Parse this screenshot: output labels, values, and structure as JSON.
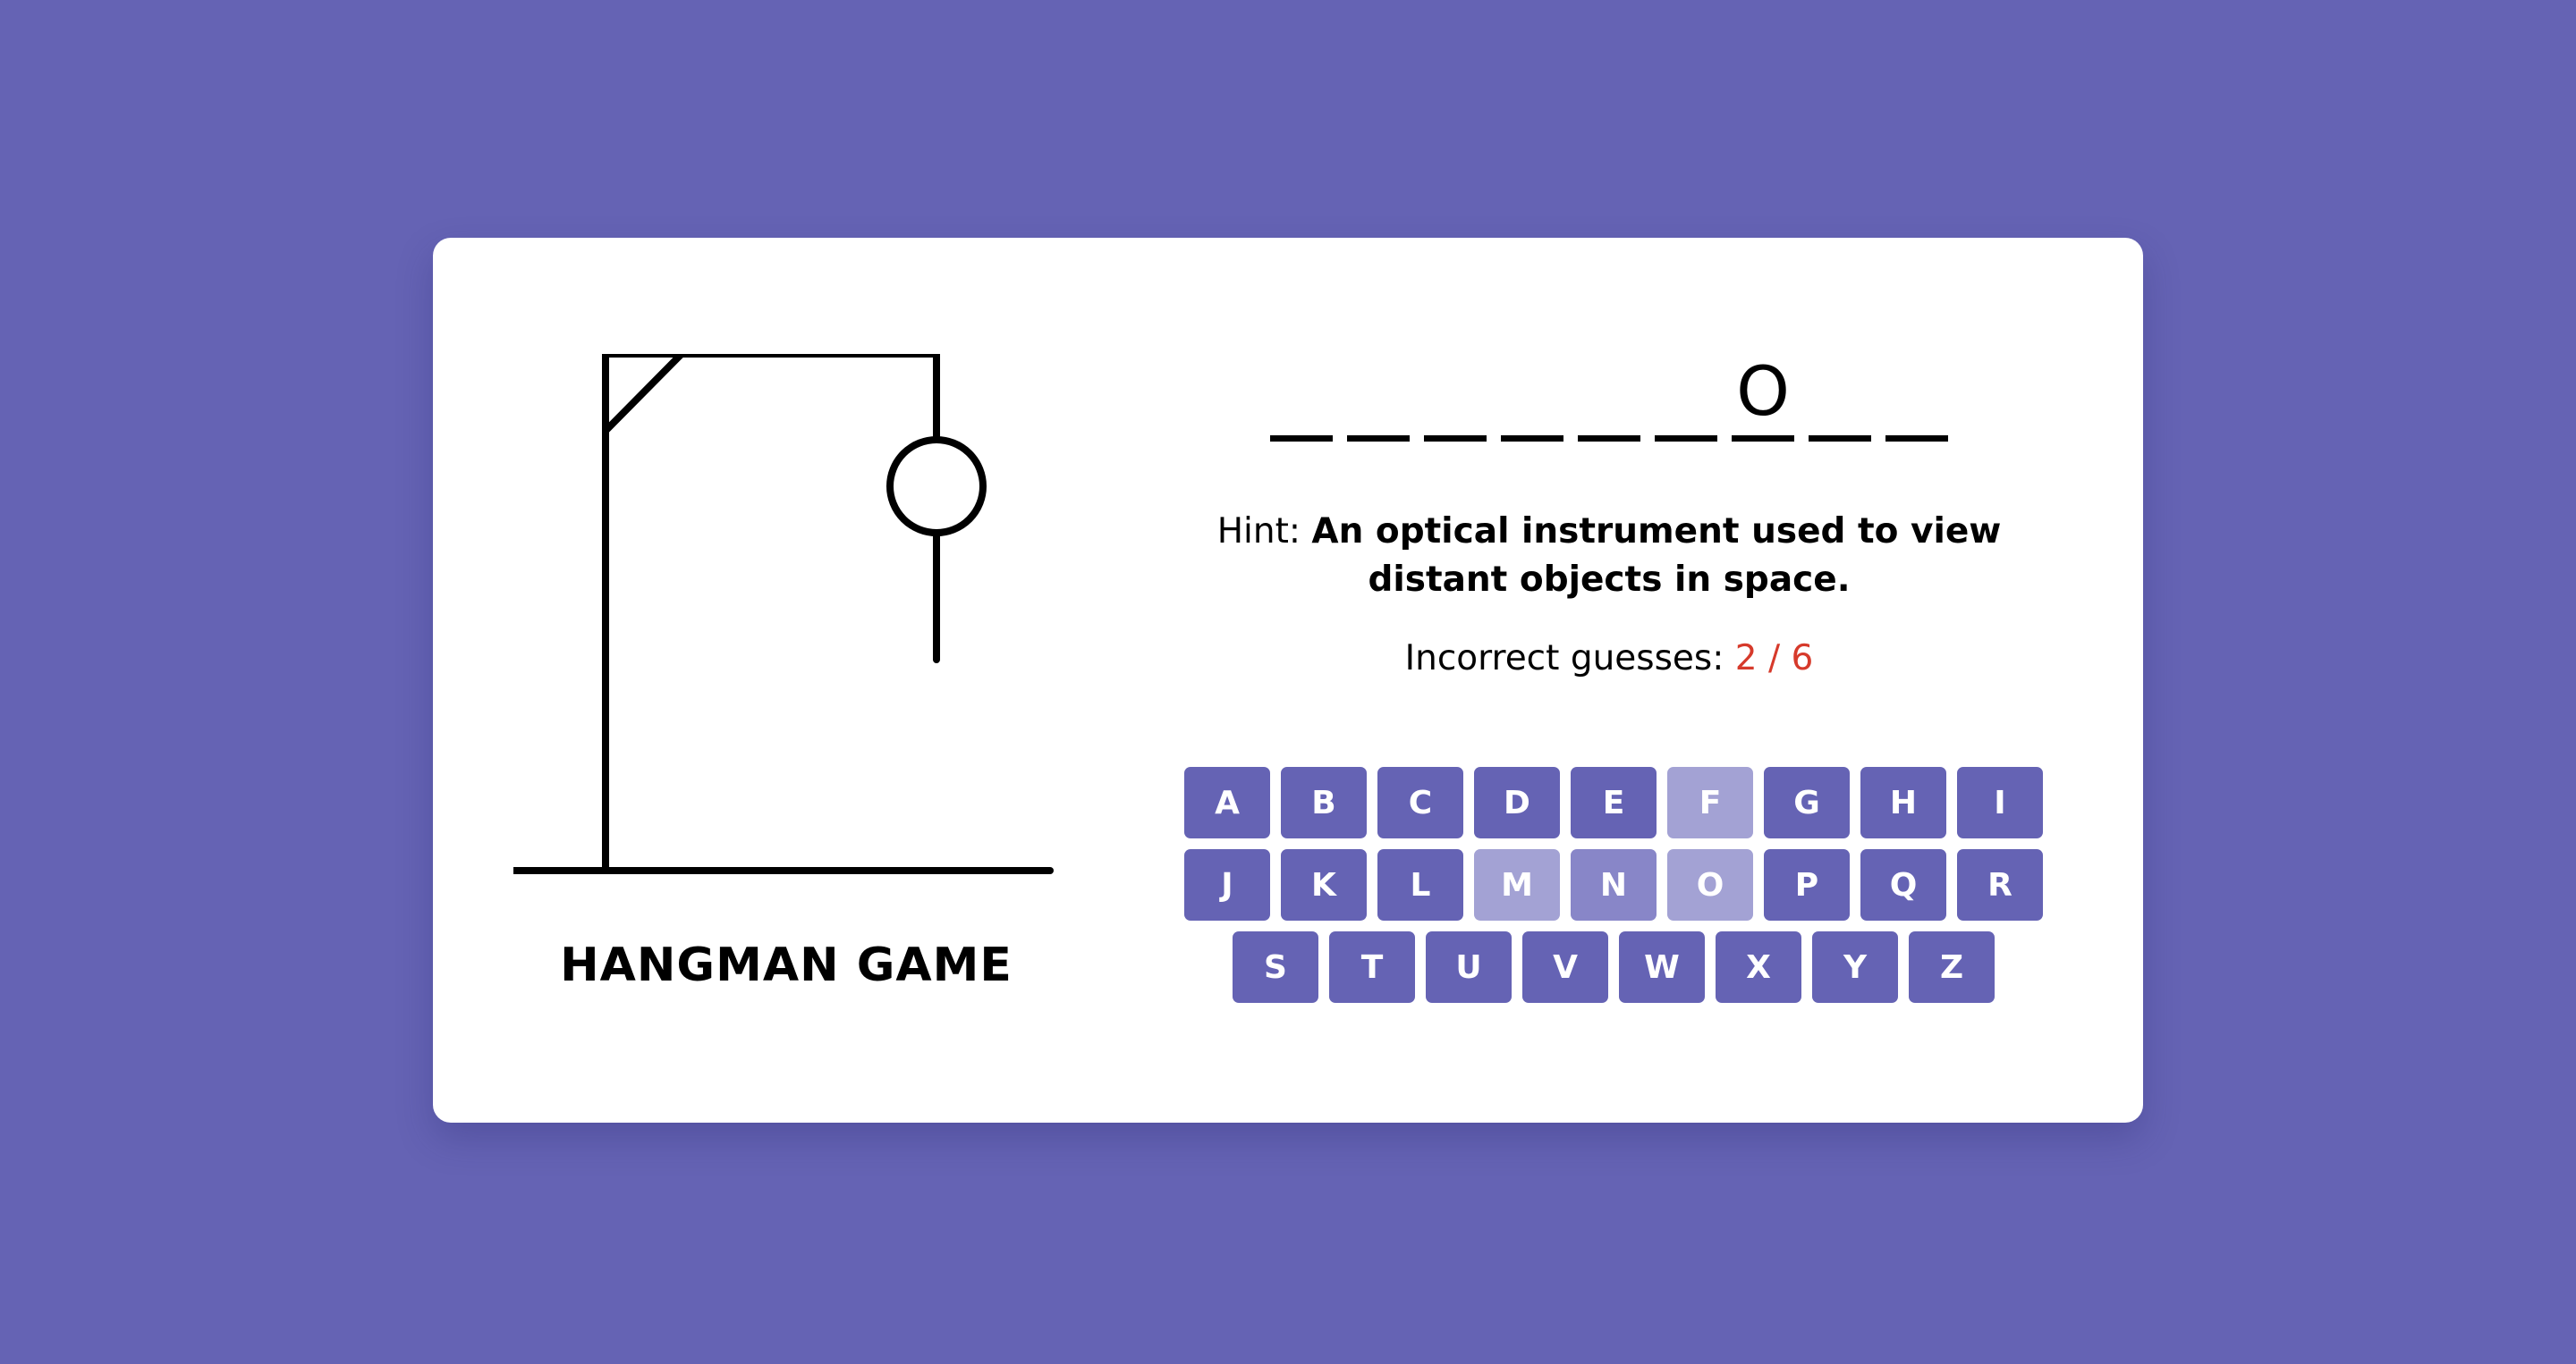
{
  "title": "HANGMAN GAME",
  "word_slots": [
    "",
    "",
    "",
    "",
    "",
    "",
    "O",
    "",
    ""
  ],
  "hint": {
    "label": "Hint:",
    "text": "An optical instrument used to view distant objects in space."
  },
  "guesses": {
    "label": "Incorrect guesses:",
    "value": "2 / 6"
  },
  "keyboard": {
    "row1": [
      "A",
      "B",
      "C",
      "D",
      "E",
      "F",
      "G",
      "H",
      "I"
    ],
    "row2": [
      "J",
      "K",
      "L",
      "M",
      "N",
      "O",
      "P",
      "Q",
      "R"
    ],
    "row3": [
      "S",
      "T",
      "U",
      "V",
      "W",
      "X",
      "Y",
      "Z"
    ],
    "disabled_letters": [
      "F",
      "M",
      "N",
      "O"
    ]
  },
  "hangman_parts_shown": [
    "head",
    "body"
  ],
  "colors": {
    "background": "#6563b4",
    "key": "#6563b4",
    "key_disabled": "#a3a2d4",
    "incorrect_count": "#d63a2b"
  }
}
